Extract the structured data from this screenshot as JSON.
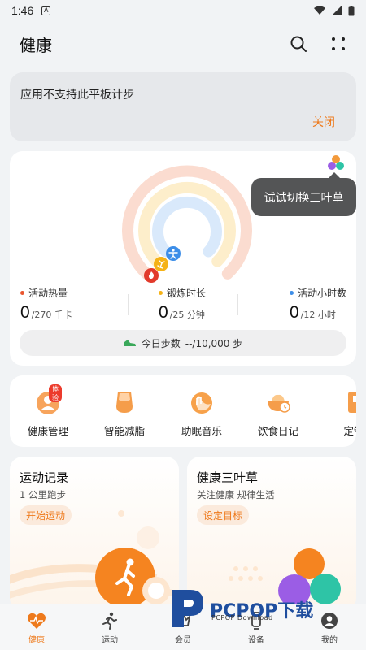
{
  "status_bar": {
    "time": "1:46"
  },
  "app_bar": {
    "title": "健康"
  },
  "notice": {
    "message": "应用不支持此平板计步",
    "close_label": "关闭"
  },
  "activity": {
    "tooltip": "试试切换三叶草",
    "metrics": [
      {
        "label": "活动热量",
        "value": "0",
        "target": "/270 千卡",
        "color": "#e9562f"
      },
      {
        "label": "锻炼时长",
        "value": "0",
        "target": "/25 分钟",
        "color": "#f5b216"
      },
      {
        "label": "活动小时数",
        "value": "0",
        "target": "/12 小时",
        "color": "#3d8ee8"
      }
    ],
    "steps_label": "今日步数",
    "steps_value": "--/10,000 步"
  },
  "services": [
    {
      "label": "健康管理",
      "icon": "health-manage-icon",
      "badge": "体验"
    },
    {
      "label": "智能减脂",
      "icon": "fat-loss-icon"
    },
    {
      "label": "助眠音乐",
      "icon": "sleep-music-icon"
    },
    {
      "label": "饮食日记",
      "icon": "diet-diary-icon"
    },
    {
      "label": "定制",
      "icon": "custom-icon"
    }
  ],
  "cards": [
    {
      "title": "运动记录",
      "subtitle": "1 公里跑步",
      "action": "开始运动"
    },
    {
      "title": "健康三叶草",
      "subtitle": "关注健康 规律生活",
      "action": "设定目标"
    }
  ],
  "bottom_tabs": [
    {
      "label": "健康",
      "icon": "heart-pulse-icon",
      "active": true
    },
    {
      "label": "运动",
      "icon": "running-icon"
    },
    {
      "label": "会员",
      "icon": "member-icon"
    },
    {
      "label": "设备",
      "icon": "device-icon"
    },
    {
      "label": "我的",
      "icon": "profile-icon"
    }
  ],
  "watermark": {
    "text": "PCPOP下载",
    "subtext": "PCPOP Download"
  },
  "colors": {
    "accent": "#ee7a1c",
    "calories": "#e9562f",
    "exercise": "#f5b216",
    "hours": "#3d8ee8"
  }
}
